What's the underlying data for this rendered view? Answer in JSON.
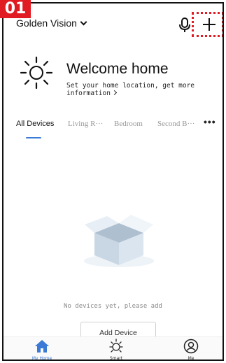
{
  "annotation": {
    "step_label": "01"
  },
  "header": {
    "home_name": "Golden Vision",
    "mic_icon": "microphone-icon",
    "add_icon": "plus-icon"
  },
  "welcome": {
    "title": "Welcome home",
    "subtitle": "Set your home location, get more information",
    "icon": "sun-icon"
  },
  "tabs": [
    {
      "label": "All Devices",
      "active": true
    },
    {
      "label": "Living R···",
      "active": false
    },
    {
      "label": "Bedroom",
      "active": false
    },
    {
      "label": "Second B···",
      "active": false
    }
  ],
  "tabs_more": "•••",
  "empty_state": {
    "message": "No devices yet, please add",
    "button_label": "Add Device",
    "illustration": "empty-box-illustration"
  },
  "bottom_nav": [
    {
      "label": "My Home",
      "icon": "home-icon",
      "active": true
    },
    {
      "label": "Smart",
      "icon": "sun-icon",
      "active": false
    },
    {
      "label": "Me",
      "icon": "user-icon",
      "active": false
    }
  ],
  "colors": {
    "accent": "#3b7bd6",
    "annotation_red": "#e11b22",
    "text": "#111111",
    "muted": "#999999"
  }
}
